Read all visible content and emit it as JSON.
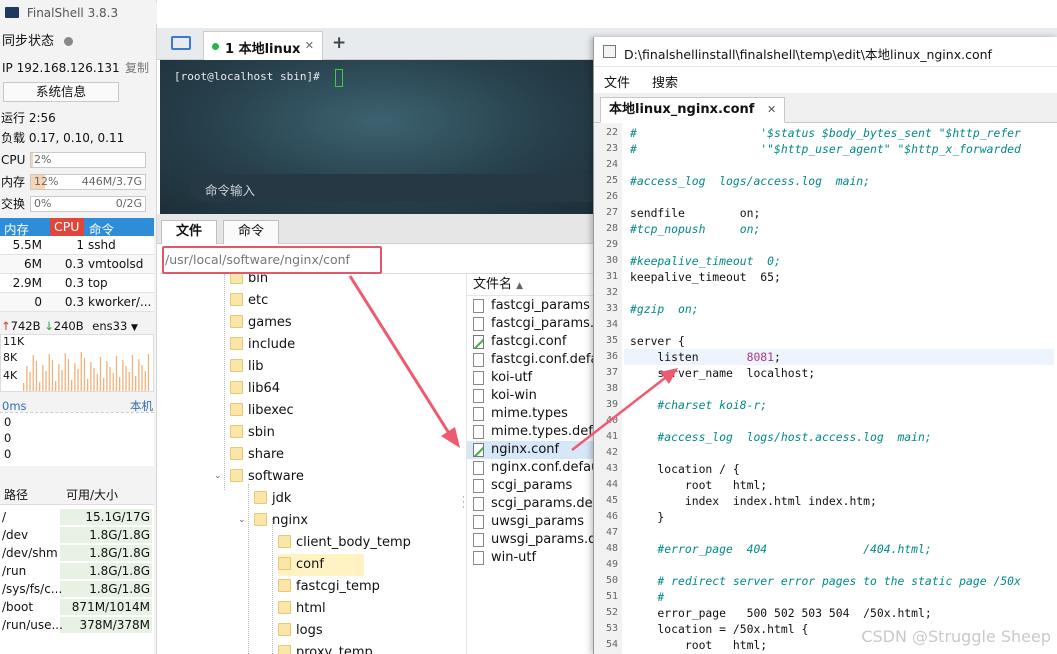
{
  "app": {
    "title": "FinalShell 3.8.3"
  },
  "status": {
    "sync_label": "同步状态",
    "ip": "IP 192.168.126.131",
    "copy": "复制",
    "sysinfo": "系统信息",
    "uptime": "运行 2:56",
    "load": "负载 0.17, 0.10, 0.11",
    "cpu_label": "CPU",
    "cpu_pct": "2%",
    "cpu_fill": 0.02,
    "mem_label": "内存",
    "mem_pct": "12%",
    "mem_val": "446M/3.7G",
    "mem_fill": 0.12,
    "swap_label": "交换",
    "swap_pct": "0%",
    "swap_val": "0/2G",
    "swap_fill": 0
  },
  "processes": {
    "headers": [
      "内存",
      "CPU",
      "命令"
    ],
    "rows": [
      {
        "mem": "5.5M",
        "cpu": "1",
        "cmd": "sshd"
      },
      {
        "mem": "6M",
        "cpu": "0.3",
        "cmd": "vmtoolsd"
      },
      {
        "mem": "2.9M",
        "cpu": "0.3",
        "cmd": "top"
      },
      {
        "mem": "0",
        "cpu": "0.3",
        "cmd": "kworker/..."
      }
    ]
  },
  "network": {
    "up": "742B",
    "down": "240B",
    "iface": "ens33",
    "y_ticks": [
      "11K",
      "8K",
      "4K"
    ]
  },
  "ping": {
    "label": "0ms",
    "host": "本机",
    "ticks": [
      "0",
      "0",
      "0"
    ]
  },
  "disks": {
    "headers": [
      "路径",
      "可用/大小"
    ],
    "rows": [
      {
        "path": "/",
        "size": "15.1G/17G",
        "fill": 0.11
      },
      {
        "path": "/dev",
        "size": "1.8G/1.8G",
        "fill": 0.0
      },
      {
        "path": "/dev/shm",
        "size": "1.8G/1.8G",
        "fill": 0.0
      },
      {
        "path": "/run",
        "size": "1.8G/1.8G",
        "fill": 0.01
      },
      {
        "path": "/sys/fs/c...",
        "size": "1.8G/1.8G",
        "fill": 0.0
      },
      {
        "path": "/boot",
        "size": "871M/1014M",
        "fill": 0.14
      },
      {
        "path": "/run/use...",
        "size": "378M/378M",
        "fill": 0.0
      }
    ]
  },
  "session_tab": {
    "label": "1 本地linux",
    "close": "✕",
    "add": "+"
  },
  "terminal": {
    "prompt": "[root@localhost sbin]#",
    "cmd_placeholder": "命令输入"
  },
  "file_tabs": {
    "files": "文件",
    "commands": "命令"
  },
  "path": "/usr/local/software/nginx/conf",
  "tree": [
    "bin",
    "etc",
    "games",
    "include",
    "lib",
    "lib64",
    "libexec",
    "sbin",
    "share",
    "software",
    "jdk",
    "nginx",
    "client_body_temp",
    "conf",
    "fastcgi_temp",
    "html",
    "logs",
    "proxy_temp"
  ],
  "file_list": {
    "header": "文件名",
    "files": [
      "fastcgi_params",
      "fastcgi_params.d",
      "fastcgi.conf",
      "fastcgi.conf.defa",
      "koi-utf",
      "koi-win",
      "mime.types",
      "mime.types.defau",
      "nginx.conf",
      "nginx.conf.defau",
      "scgi_params",
      "scgi_params.defa",
      "uwsgi_params",
      "uwsgi_params.de",
      "win-utf"
    ]
  },
  "editor": {
    "title": "D:\\finalshellinstall\\finalshell\\temp\\edit\\本地linux_nginx.conf",
    "menu": [
      "文件",
      "搜索"
    ],
    "tab": "本地linux_nginx.conf",
    "tab_close": "✕",
    "lines": [
      {
        "n": "22",
        "t": "#                  '$status $body_bytes_sent \"$http_refer",
        "c": true
      },
      {
        "n": "23",
        "t": "#                  '\"$http_user_agent\" \"$http_x_forwarded",
        "c": true
      },
      {
        "n": "24",
        "t": "",
        "c": false
      },
      {
        "n": "25",
        "t": "#access_log  logs/access.log  main;",
        "c": true
      },
      {
        "n": "26",
        "t": "",
        "c": false
      },
      {
        "n": "27",
        "t": "sendfile        on;",
        "c": false
      },
      {
        "n": "28",
        "t": "#tcp_nopush     on;",
        "c": true
      },
      {
        "n": "29",
        "t": "",
        "c": false
      },
      {
        "n": "30",
        "t": "#keepalive_timeout  0;",
        "c": true
      },
      {
        "n": "31",
        "t": "keepalive_timeout  65;",
        "c": false
      },
      {
        "n": "32",
        "t": "",
        "c": false
      },
      {
        "n": "33",
        "t": "#gzip  on;",
        "c": true
      },
      {
        "n": "34",
        "t": "",
        "c": false
      },
      {
        "n": "35",
        "t": "server {",
        "c": false
      },
      {
        "n": "36",
        "t": "    listen       8081;",
        "c": false
      },
      {
        "n": "37",
        "t": "    server_name  localhost;",
        "c": false
      },
      {
        "n": "38",
        "t": "",
        "c": false
      },
      {
        "n": "39",
        "t": "    #charset koi8-r;",
        "c": true
      },
      {
        "n": "40",
        "t": "",
        "c": false
      },
      {
        "n": "41",
        "t": "    #access_log  logs/host.access.log  main;",
        "c": true
      },
      {
        "n": "42",
        "t": "",
        "c": false
      },
      {
        "n": "43",
        "t": "    location / {",
        "c": false
      },
      {
        "n": "44",
        "t": "        root   html;",
        "c": false
      },
      {
        "n": "45",
        "t": "        index  index.html index.htm;",
        "c": false
      },
      {
        "n": "46",
        "t": "    }",
        "c": false
      },
      {
        "n": "47",
        "t": "",
        "c": false
      },
      {
        "n": "48",
        "t": "    #error_page  404              /404.html;",
        "c": true
      },
      {
        "n": "49",
        "t": "",
        "c": false
      },
      {
        "n": "50",
        "t": "    # redirect server error pages to the static page /50x",
        "c": true
      },
      {
        "n": "51",
        "t": "    #",
        "c": true
      },
      {
        "n": "52",
        "t": "    error_page   500 502 503 504  /50x.html;",
        "c": false
      },
      {
        "n": "53",
        "t": "    location = /50x.html {",
        "c": false
      },
      {
        "n": "54",
        "t": "        root   html;",
        "c": false
      }
    ]
  },
  "watermark": "CSDN @Struggle Sheep",
  "colors": {
    "accent": "#2f8cd6",
    "annotation": "#e4566a",
    "cpu_header": "#e0463c"
  }
}
